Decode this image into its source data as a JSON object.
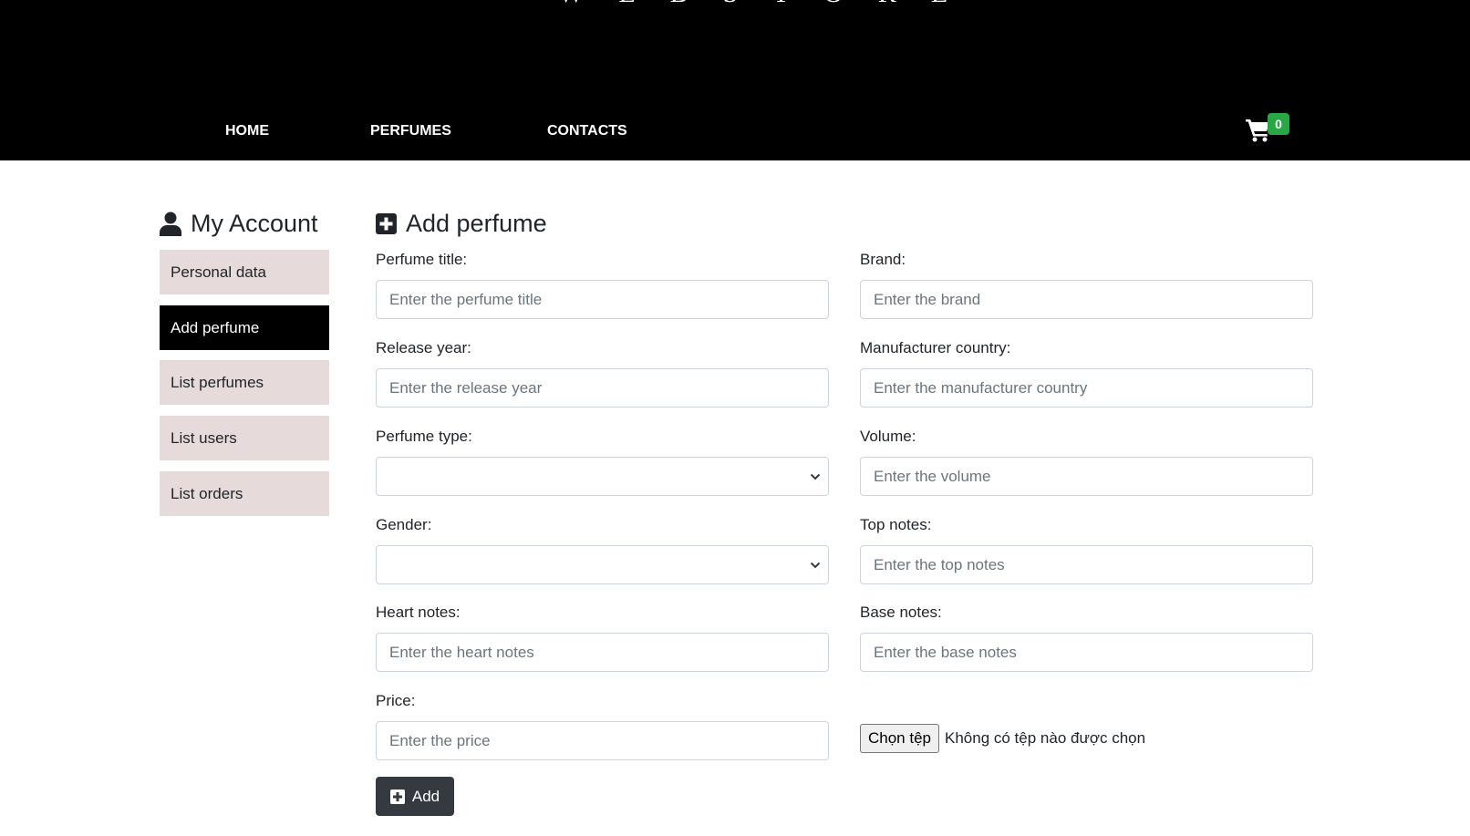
{
  "header": {
    "logo": "WEBSTORE",
    "nav": [
      "HOME",
      "PERFUMES",
      "CONTACTS"
    ],
    "cart_count": "0",
    "cart_icon": "shopping-cart-icon",
    "badge_color": "#28a745"
  },
  "sidebar": {
    "title": "My Account",
    "title_icon": "user-icon",
    "items": [
      "Personal data",
      "Add perfume",
      "List perfumes",
      "List users",
      "List orders"
    ],
    "active": "Add perfume"
  },
  "form": {
    "title": "Add perfume",
    "title_icon": "plus-square-icon",
    "fields": {
      "perfume_title": {
        "label": "Perfume title:",
        "placeholder": "Enter the perfume title"
      },
      "brand": {
        "label": "Brand:",
        "placeholder": "Enter the brand"
      },
      "release_year": {
        "label": "Release year:",
        "placeholder": "Enter the release year"
      },
      "manufacturer_country": {
        "label": "Manufacturer country:",
        "placeholder": "Enter the manufacturer country"
      },
      "perfume_type": {
        "label": "Perfume type:",
        "value": ""
      },
      "volume": {
        "label": "Volume:",
        "placeholder": "Enter the volume"
      },
      "gender": {
        "label": "Gender:",
        "value": ""
      },
      "top_notes": {
        "label": "Top notes:",
        "placeholder": "Enter the top notes"
      },
      "heart_notes": {
        "label": "Heart notes:",
        "placeholder": "Enter the heart notes"
      },
      "base_notes": {
        "label": "Base notes:",
        "placeholder": "Enter the base notes"
      },
      "price": {
        "label": "Price:",
        "placeholder": "Enter the price"
      }
    },
    "file": {
      "button": "Chọn tệp",
      "status": "Không có tệp nào được chọn"
    },
    "submit": "Add"
  }
}
